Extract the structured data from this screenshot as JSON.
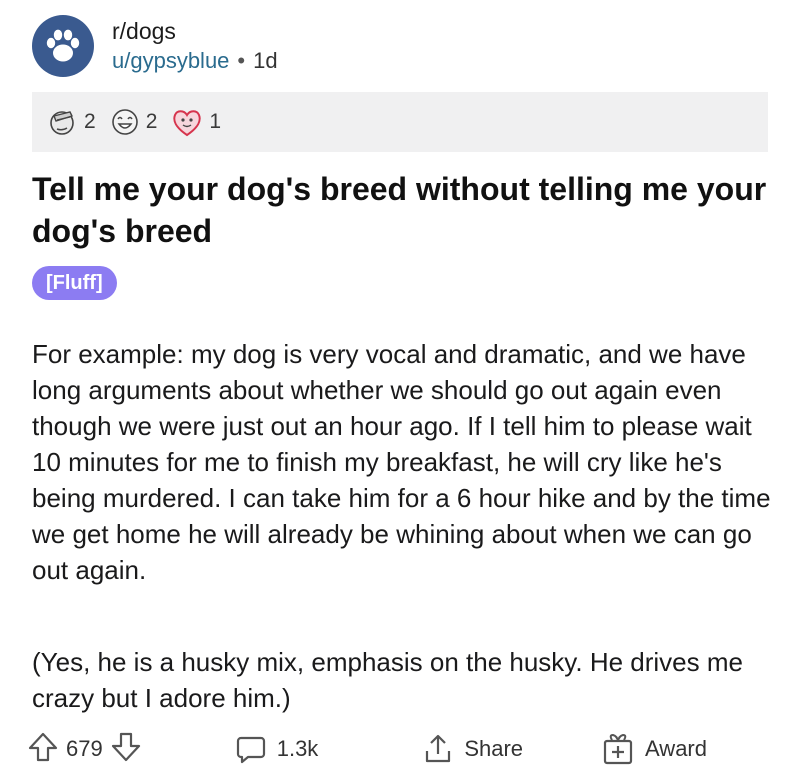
{
  "post": {
    "subreddit": "r/dogs",
    "author": "u/gypsyblue",
    "separator": "•",
    "age": "1d",
    "title": "Tell me your dog's breed without telling me your dog's breed",
    "flair": "[Fluff]",
    "body_paragraph_1": "For example: my dog is very vocal and dramatic, and we have long arguments about whether we should go out again even though we were just out an hour ago. If I tell him to please wait 10 minutes for me to finish my breakfast, he will cry like he's being murdered. I can take him for a 6 hour hike and by the time we get home he will already be whining about when we can go out again.",
    "body_paragraph_2": "(Yes, he is a husky mix, emphasis on the husky. He drives me crazy but I adore him.)"
  },
  "awards": [
    {
      "icon": "facepalm-award-icon",
      "count": "2"
    },
    {
      "icon": "laughing-face-award-icon",
      "count": "2"
    },
    {
      "icon": "heart-face-award-icon",
      "count": "1"
    }
  ],
  "actions": {
    "score": "679",
    "comments": "1.3k",
    "share_label": "Share",
    "award_label": "Award"
  },
  "colors": {
    "avatar_bg": "#3a5a8f",
    "author": "#2a6b8e",
    "flair_bg": "#8c7cf2",
    "awards_bar_bg": "#f0f0f1"
  }
}
